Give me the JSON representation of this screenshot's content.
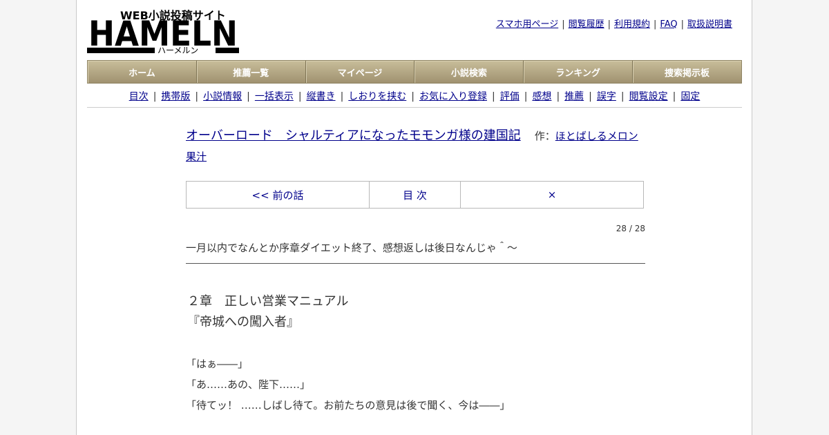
{
  "logo": {
    "main": "HAMELN",
    "tagline": "WEB小説投稿サイト",
    "kana": "ハーメルン"
  },
  "top_links": [
    "スマホ用ページ",
    "閲覧履歴",
    "利用規約",
    "FAQ",
    "取扱説明書"
  ],
  "main_nav": [
    "ホーム",
    "推薦一覧",
    "マイページ",
    "小説検索",
    "ランキング",
    "捜索掲示板"
  ],
  "sub_nav": [
    "目次",
    "携帯版",
    "小説情報",
    "一括表示",
    "縦書き",
    "しおりを挟む",
    "お気に入り登録",
    "評価",
    "感想",
    "推薦",
    "誤字",
    "閲覧設定",
    "固定"
  ],
  "novel": {
    "title": "オーバーロード　シャルティアになったモモンガ様の建国記",
    "author_label": "作：",
    "author": "ほとばしるメロン果汁"
  },
  "episode_nav": {
    "prev": "<< 前の話",
    "toc": "目 次",
    "next": "×"
  },
  "page_count": "28 / 28",
  "maegaki": "一月以内でなんとか序章ダイエット終了、感想返しは後日なんじゃ＾～",
  "chapter": {
    "line1": "２章　正しい営業マニュアル",
    "line2": "『帝城への闖入者』"
  },
  "body_lines": [
    "「はぁ――」",
    "「あ……あの、陛下……」",
    "「待てッ！ ……しばし待て。お前たちの意見は後で聞く、今は――」"
  ],
  "colors": {
    "link": "#00008b",
    "nav_bg": "#b0a27f",
    "nav_text": "#ffffff"
  }
}
